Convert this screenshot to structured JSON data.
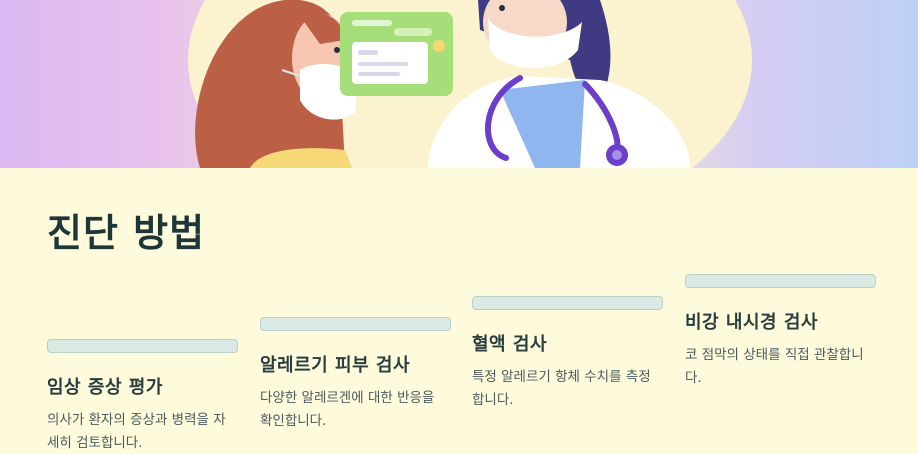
{
  "title": "진단 방법",
  "steps": [
    {
      "title": "임상 증상 평가",
      "desc": "의사가 환자의 증상과 병력을 자세히 검토합니다."
    },
    {
      "title": "알레르기 피부 검사",
      "desc": "다양한 알레르겐에 대한 반응을 확인합니다."
    },
    {
      "title": "혈액 검사",
      "desc": "특정 알레르기 항체 수치를 측정합니다."
    },
    {
      "title": "비강 내시경 검사",
      "desc": "코 점막의 상태를 직접 관찰합니다."
    }
  ],
  "colors": {
    "background": "#fefbdc",
    "progress_bar": "#dbeae4",
    "heading": "#1f3638"
  }
}
